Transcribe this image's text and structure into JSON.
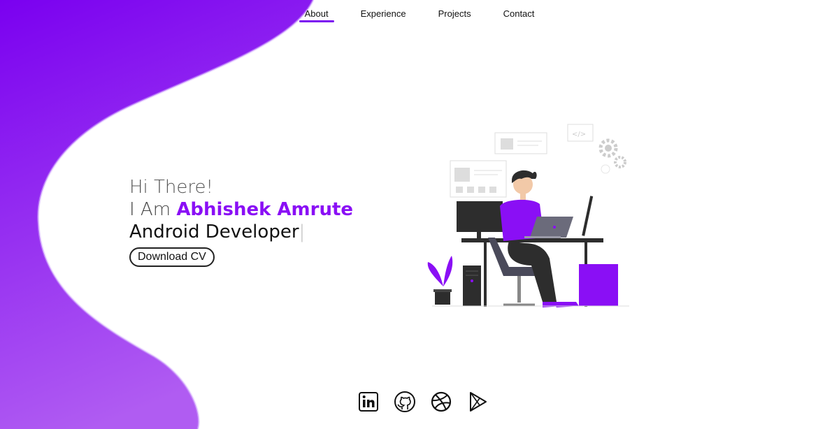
{
  "nav": {
    "items": [
      {
        "label": "About",
        "active": true
      },
      {
        "label": "Experience",
        "active": false
      },
      {
        "label": "Projects",
        "active": false
      },
      {
        "label": "Contact",
        "active": false
      }
    ]
  },
  "hero": {
    "greeting": "Hi There!",
    "intro_prefix": "I Am ",
    "name": "Abhishek Amrute",
    "role": "Android Developer",
    "cursor": "|",
    "download_label": "Download CV"
  },
  "colors": {
    "accent": "#8a0ff5",
    "blob_top": "#7b00f2",
    "blob_bottom": "#b04df0"
  },
  "social": {
    "icons": [
      "linkedin-icon",
      "github-icon",
      "dribbble-icon",
      "play-store-icon"
    ]
  }
}
